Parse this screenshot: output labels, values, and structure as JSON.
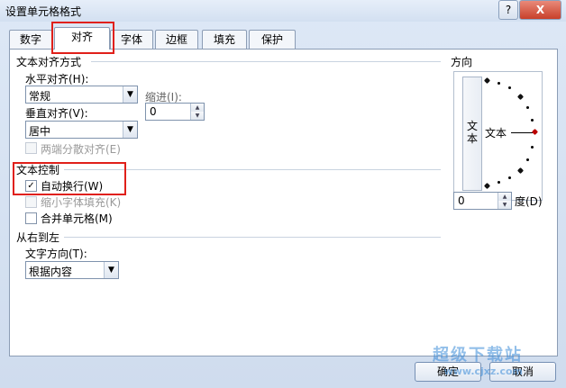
{
  "window": {
    "title": "设置单元格格式",
    "help_label": "?",
    "close_label": "X"
  },
  "tabs": [
    {
      "label": "数字"
    },
    {
      "label": "对齐"
    },
    {
      "label": "字体"
    },
    {
      "label": "边框"
    },
    {
      "label": "填充"
    },
    {
      "label": "保护"
    }
  ],
  "alignment": {
    "section_title": "文本对齐方式",
    "horizontal_label": "水平对齐(H):",
    "horizontal_value": "常规",
    "indent_label": "缩进(I):",
    "indent_value": "0",
    "vertical_label": "垂直对齐(V):",
    "vertical_value": "居中",
    "distributed_label": "两端分散对齐(E)"
  },
  "text_control": {
    "section_title": "文本控制",
    "wrap_label": "自动换行(W)",
    "wrap_checked": true,
    "shrink_label": "缩小字体填充(K)",
    "merge_label": "合并单元格(M)"
  },
  "rtl": {
    "section_title": "从右到左",
    "direction_label": "文字方向(T):",
    "direction_value": "根据内容"
  },
  "orientation": {
    "section_title": "方向",
    "vertical_text": "文本",
    "horizontal_text": "文本",
    "degrees_value": "0",
    "degrees_label": "度(D)"
  },
  "buttons": {
    "ok": "确定",
    "cancel": "取消"
  },
  "watermark": {
    "text": "超级下载站",
    "url": "www.cjxz.com"
  },
  "colors": {
    "highlight": "#e0201a",
    "watermark": "#3a8bd8"
  }
}
